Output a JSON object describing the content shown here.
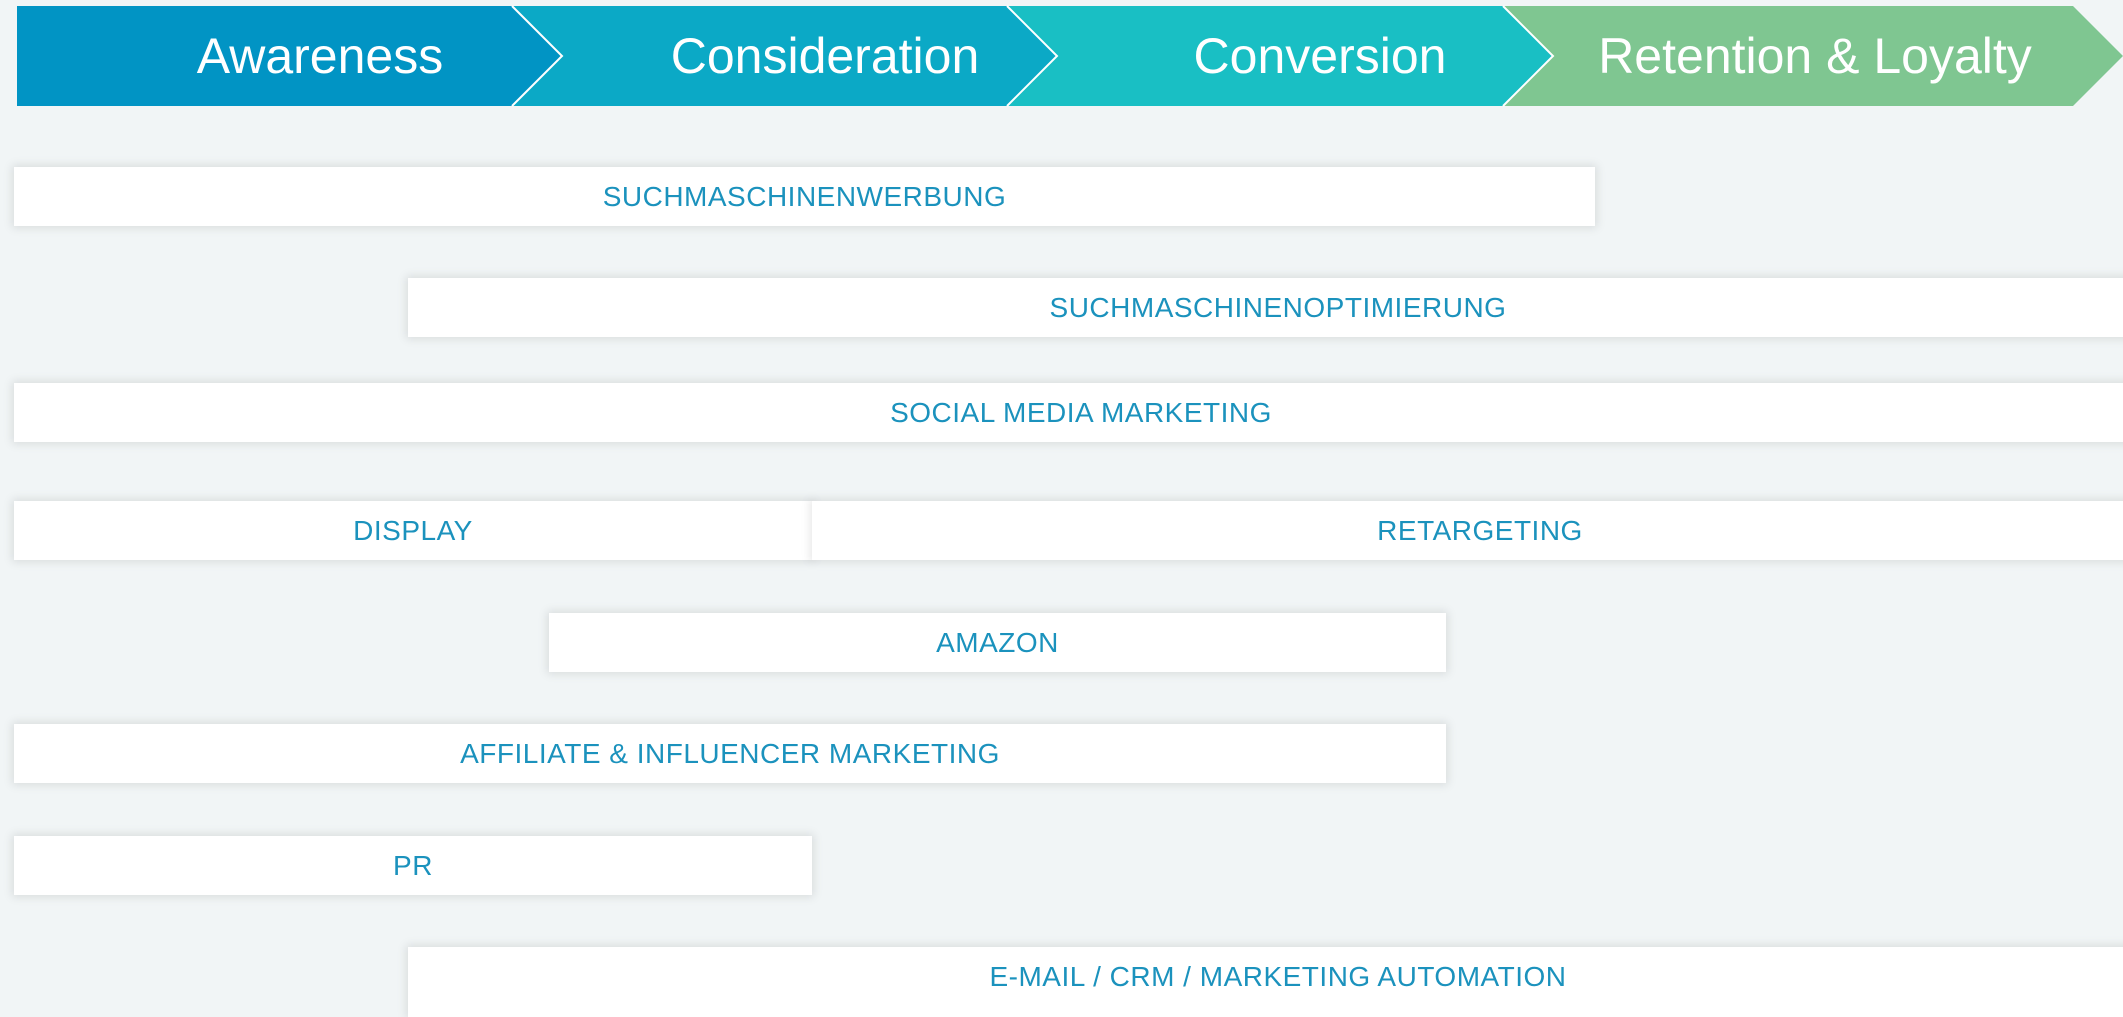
{
  "stages": [
    {
      "label": "Awareness",
      "color": "#0194c4"
    },
    {
      "label": "Consideration",
      "color": "#0ba9c6"
    },
    {
      "label": "Conversion",
      "color": "#19bfc4"
    },
    {
      "label": "Retention & Loyalty",
      "color": "#7fc691"
    }
  ],
  "channels": {
    "sea": "SUCHMASCHINENWERBUNG",
    "seo": "SUCHMASCHINENOPTIMIERUNG",
    "smm": "SOCIAL MEDIA MARKETING",
    "display": "DISPLAY",
    "retargeting": "RETARGETING",
    "amazon": "AMAZON",
    "affiliate": "AFFILIATE & INFLUENCER MARKETING",
    "pr": "PR",
    "email": "E-MAIL / CRM / MARKETING AUTOMATION"
  },
  "text_color": "#1b92bd",
  "bar_background": "#ffffff"
}
